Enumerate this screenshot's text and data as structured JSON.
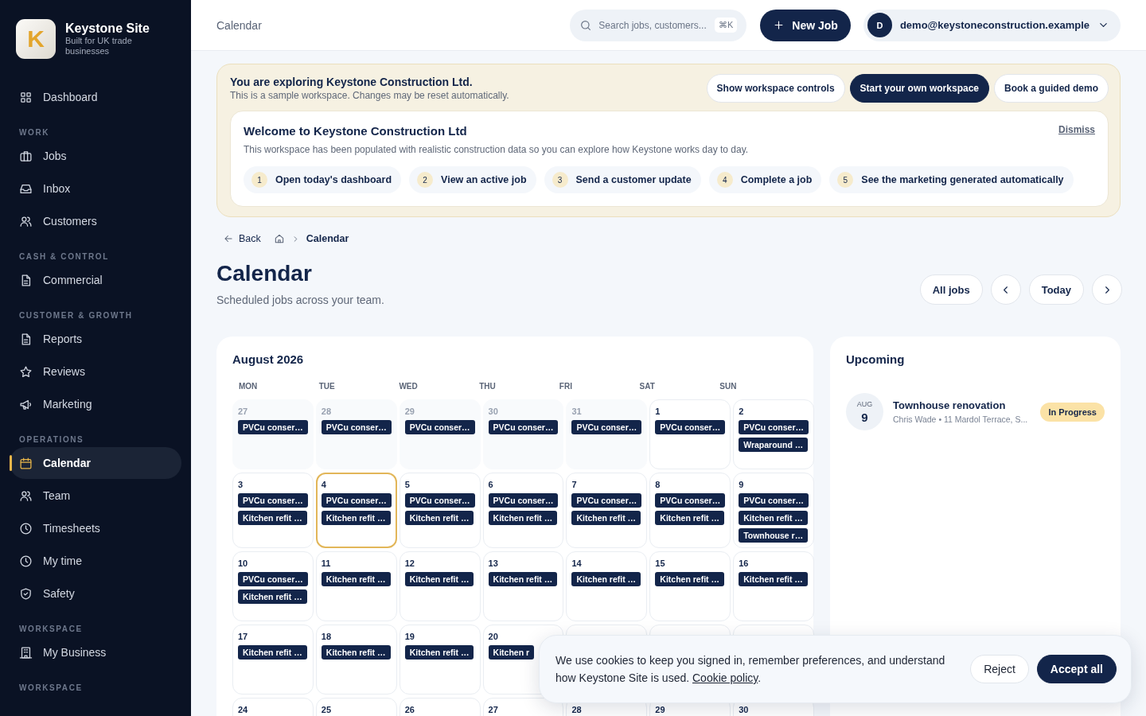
{
  "brand": {
    "logo_letter": "K",
    "name": "Keystone Site",
    "tagline": "Built for UK trade businesses"
  },
  "sidebar": {
    "sections": [
      {
        "items": [
          {
            "label": "Dashboard",
            "selected": false
          }
        ]
      },
      {
        "heading": "WORK",
        "items": [
          {
            "label": "Jobs",
            "selected": false
          },
          {
            "label": "Inbox",
            "selected": false
          },
          {
            "label": "Customers",
            "selected": false
          }
        ]
      },
      {
        "heading": "CASH & CONTROL",
        "items": [
          {
            "label": "Commercial",
            "selected": false
          }
        ]
      },
      {
        "heading": "CUSTOMER & GROWTH",
        "items": [
          {
            "label": "Reports",
            "selected": false
          },
          {
            "label": "Reviews",
            "selected": false
          },
          {
            "label": "Marketing",
            "selected": false
          }
        ]
      },
      {
        "heading": "OPERATIONS",
        "items": [
          {
            "label": "Calendar",
            "selected": true
          },
          {
            "label": "Team",
            "selected": false
          },
          {
            "label": "Timesheets",
            "selected": false
          },
          {
            "label": "My time",
            "selected": false
          },
          {
            "label": "Safety",
            "selected": false
          }
        ]
      },
      {
        "heading": "WORKSPACE",
        "items": [
          {
            "label": "My Business",
            "selected": false
          }
        ]
      },
      {
        "heading": "WORKSPACE"
      }
    ]
  },
  "header": {
    "title": "Calendar",
    "search": {
      "placeholder": "Search jobs, customers...",
      "shortcut": "⌘K"
    },
    "new_button": "New Job",
    "user": {
      "initial": "D",
      "email": "demo@keystoneconstruction.example"
    }
  },
  "demo_banner": {
    "title": "You are exploring Keystone Construction Ltd.",
    "subtitle": "This is a sample workspace. Changes may be reset automatically.",
    "buttons": [
      {
        "label": "Show workspace controls",
        "kind": "outline"
      },
      {
        "label": "Start your own workspace",
        "kind": "primary"
      },
      {
        "label": "Book a guided demo",
        "kind": "outline"
      }
    ],
    "welcome": {
      "title": "Welcome to Keystone Construction Ltd",
      "dismiss": "Dismiss",
      "text": "This workspace has been populated with realistic construction data so you can explore how Keystone works day to day.",
      "steps": [
        {
          "number": "1",
          "label": "Open today's dashboard"
        },
        {
          "number": "2",
          "label": "View an active job"
        },
        {
          "number": "3",
          "label": "Send a customer update"
        },
        {
          "number": "4",
          "label": "Complete a job"
        },
        {
          "number": "5",
          "label": "See the marketing generated automatically"
        }
      ]
    }
  },
  "breadcrumb": {
    "back": "Back",
    "current": "Calendar"
  },
  "page": {
    "title": "Calendar",
    "subtitle": "Scheduled jobs across your team.",
    "filter": "All jobs",
    "today": "Today"
  },
  "calendar": {
    "month": "August 2026",
    "weekdays": [
      "MON",
      "TUE",
      "WED",
      "THU",
      "FRI",
      "SAT",
      "SUN"
    ],
    "weeks": [
      [
        {
          "day": "27",
          "outside_month": true,
          "today": false,
          "events": [
            "PVCu conser…"
          ]
        },
        {
          "day": "28",
          "outside_month": true,
          "today": false,
          "events": [
            "PVCu conser…"
          ]
        },
        {
          "day": "29",
          "outside_month": true,
          "today": false,
          "events": [
            "PVCu conser…"
          ]
        },
        {
          "day": "30",
          "outside_month": true,
          "today": false,
          "events": [
            "PVCu conser…"
          ]
        },
        {
          "day": "31",
          "outside_month": true,
          "today": false,
          "events": [
            "PVCu conser…"
          ]
        },
        {
          "day": "1",
          "outside_month": false,
          "today": false,
          "events": [
            "PVCu conser…"
          ]
        },
        {
          "day": "2",
          "outside_month": false,
          "today": false,
          "events": [
            "PVCu conser…",
            "Wraparound …"
          ]
        }
      ],
      [
        {
          "day": "3",
          "outside_month": false,
          "today": false,
          "events": [
            "PVCu conser…",
            "Kitchen refit …"
          ]
        },
        {
          "day": "4",
          "outside_month": false,
          "today": true,
          "events": [
            "PVCu conser…",
            "Kitchen refit …"
          ]
        },
        {
          "day": "5",
          "outside_month": false,
          "today": false,
          "events": [
            "PVCu conser…",
            "Kitchen refit …"
          ]
        },
        {
          "day": "6",
          "outside_month": false,
          "today": false,
          "events": [
            "PVCu conser…",
            "Kitchen refit …"
          ]
        },
        {
          "day": "7",
          "outside_month": false,
          "today": false,
          "events": [
            "PVCu conser…",
            "Kitchen refit …"
          ]
        },
        {
          "day": "8",
          "outside_month": false,
          "today": false,
          "events": [
            "PVCu conser…",
            "Kitchen refit …"
          ]
        },
        {
          "day": "9",
          "outside_month": false,
          "today": false,
          "events": [
            "PVCu conser…",
            "Kitchen refit …",
            "Townhouse r…"
          ]
        }
      ],
      [
        {
          "day": "10",
          "outside_month": false,
          "today": false,
          "events": [
            "PVCu conser…",
            "Kitchen refit …"
          ]
        },
        {
          "day": "11",
          "outside_month": false,
          "today": false,
          "events": [
            "Kitchen refit …"
          ]
        },
        {
          "day": "12",
          "outside_month": false,
          "today": false,
          "events": [
            "Kitchen refit …"
          ]
        },
        {
          "day": "13",
          "outside_month": false,
          "today": false,
          "events": [
            "Kitchen refit …"
          ]
        },
        {
          "day": "14",
          "outside_month": false,
          "today": false,
          "events": [
            "Kitchen refit …"
          ]
        },
        {
          "day": "15",
          "outside_month": false,
          "today": false,
          "events": [
            "Kitchen refit …"
          ]
        },
        {
          "day": "16",
          "outside_month": false,
          "today": false,
          "events": [
            "Kitchen refit …"
          ]
        }
      ],
      [
        {
          "day": "17",
          "outside_month": false,
          "today": false,
          "events": [
            "Kitchen refit …"
          ]
        },
        {
          "day": "18",
          "outside_month": false,
          "today": false,
          "events": [
            "Kitchen refit …"
          ]
        },
        {
          "day": "19",
          "outside_month": false,
          "today": false,
          "events": [
            "Kitchen refit …"
          ]
        },
        {
          "day": "20",
          "outside_month": false,
          "today": false,
          "events": [
            "Kitchen r"
          ]
        },
        {
          "outside_month": false,
          "today": false
        },
        {
          "outside_month": false,
          "today": false
        },
        {
          "outside_month": false,
          "today": false
        }
      ],
      [
        {
          "day": "24",
          "outside_month": false,
          "today": false
        },
        {
          "day": "25",
          "outside_month": false,
          "today": false
        },
        {
          "day": "26",
          "outside_month": false,
          "today": false
        },
        {
          "day": "27",
          "outside_month": false,
          "today": false
        },
        {
          "day": "28",
          "outside_month": false,
          "today": false
        },
        {
          "day": "29",
          "outside_month": false,
          "today": false
        },
        {
          "day": "30",
          "outside_month": false,
          "today": false
        }
      ]
    ]
  },
  "upcoming": {
    "title": "Upcoming",
    "items": [
      {
        "month": "AUG",
        "day": "9",
        "title": "Townhouse renovation",
        "detail": "Chris Wade • 11 Mardol Terrace, S...",
        "status": "In Progress"
      }
    ]
  },
  "cookie_banner": {
    "text": "We use cookies to keep you signed in, remember preferences, and understand how Keystone Site is used.",
    "link": "Cookie policy",
    "after_link": ".",
    "reject": "Reject",
    "accept": "Accept all"
  }
}
